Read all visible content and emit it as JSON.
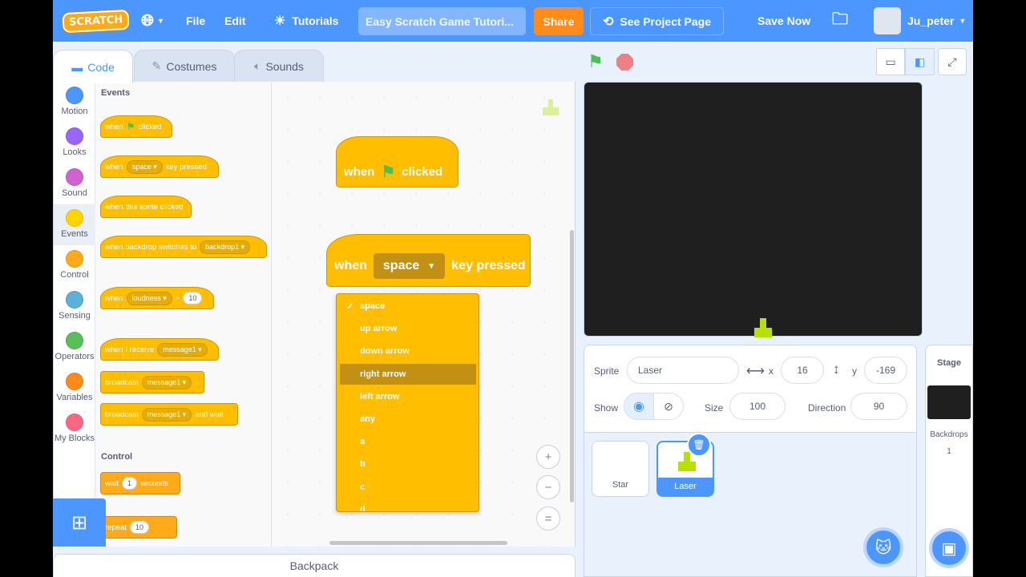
{
  "menu": {
    "logo": "SCRATCH",
    "file": "File",
    "edit": "Edit",
    "tutorials": "Tutorials",
    "project_title": "Easy Scratch Game Tutori...",
    "share": "Share",
    "see_project": "See Project Page",
    "save_now": "Save Now",
    "username": "Ju_peter"
  },
  "tabs": {
    "code": "Code",
    "costumes": "Costumes",
    "sounds": "Sounds"
  },
  "categories": [
    {
      "label": "Motion",
      "color": "#4c97ff"
    },
    {
      "label": "Looks",
      "color": "#9966ff"
    },
    {
      "label": "Sound",
      "color": "#cf63cf"
    },
    {
      "label": "Events",
      "color": "#ffd500"
    },
    {
      "label": "Control",
      "color": "#ffab19"
    },
    {
      "label": "Sensing",
      "color": "#5cb1d6"
    },
    {
      "label": "Operators",
      "color": "#59c059"
    },
    {
      "label": "Variables",
      "color": "#ff8c1a"
    },
    {
      "label": "My Blocks",
      "color": "#ff6680"
    }
  ],
  "flyout": {
    "events_heading": "Events",
    "when": "when",
    "clicked": "clicked",
    "space": "space",
    "key_pressed": "key pressed",
    "when_sprite_clicked": "when this sprite clicked",
    "when_backdrop": "when backdrop switches to",
    "backdrop1": "backdrop1",
    "loudness": "loudness",
    "gt": ">",
    "ten": "10",
    "when_receive": "when I receive",
    "message1": "message1",
    "broadcast": "broadcast",
    "and_wait": "and wait",
    "control_heading": "Control",
    "wait": "wait",
    "one": "1",
    "seconds": "seconds",
    "repeat": "repeat"
  },
  "script": {
    "when": "when",
    "clicked": "clicked",
    "space": "space",
    "key_pressed": "key pressed"
  },
  "dropdown_options": [
    "space",
    "up arrow",
    "down arrow",
    "right arrow",
    "left arrow",
    "any",
    "a",
    "b",
    "c",
    "d"
  ],
  "dropdown_selected": "space",
  "dropdown_hovered": "right arrow",
  "zoom": {
    "in": "+",
    "out": "−",
    "reset": "="
  },
  "backpack": "Backpack",
  "sprite_info": {
    "sprite_label": "Sprite",
    "sprite_name": "Laser",
    "x_label": "x",
    "x_value": "16",
    "y_label": "y",
    "y_value": "-169",
    "show_label": "Show",
    "size_label": "Size",
    "size_value": "100",
    "direction_label": "Direction",
    "direction_value": "90"
  },
  "sprites": [
    {
      "name": "Star"
    },
    {
      "name": "Laser"
    }
  ],
  "stage_pane": {
    "title": "Stage",
    "backdrops_label": "Backdrops",
    "backdrops_count": "1"
  },
  "colors": {
    "accent": "#4c97ff",
    "events": "#ffbf00",
    "share": "#ff8c1a",
    "laser": "#b8e000"
  }
}
